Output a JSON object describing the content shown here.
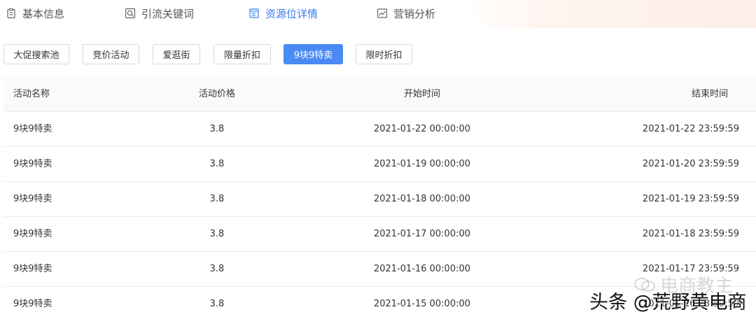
{
  "tabs": [
    {
      "label": "基本信息",
      "icon": "clipboard-icon",
      "active": false
    },
    {
      "label": "引流关键词",
      "icon": "search-doc-icon",
      "active": false
    },
    {
      "label": "资源位详情",
      "icon": "list-doc-icon",
      "active": true
    },
    {
      "label": "营销分析",
      "icon": "chart-icon",
      "active": false
    }
  ],
  "filters": [
    {
      "label": "大促搜索池",
      "active": false
    },
    {
      "label": "竞价活动",
      "active": false
    },
    {
      "label": "爱逛街",
      "active": false
    },
    {
      "label": "限量折扣",
      "active": false
    },
    {
      "label": "9块9特卖",
      "active": true
    },
    {
      "label": "限时折扣",
      "active": false
    }
  ],
  "table": {
    "headers": {
      "name": "活动名称",
      "price": "活动价格",
      "start": "开始时间",
      "end": "结束时间"
    },
    "rows": [
      {
        "name": "9块9特卖",
        "price": "3.8",
        "start": "2021-01-22 00:00:00",
        "end": "2021-01-22 23:59:59"
      },
      {
        "name": "9块9特卖",
        "price": "3.8",
        "start": "2021-01-19 00:00:00",
        "end": "2021-01-20 23:59:59"
      },
      {
        "name": "9块9特卖",
        "price": "3.8",
        "start": "2021-01-18 00:00:00",
        "end": "2021-01-19 23:59:59"
      },
      {
        "name": "9块9特卖",
        "price": "3.8",
        "start": "2021-01-17 00:00:00",
        "end": "2021-01-18 23:59:59"
      },
      {
        "name": "9块9特卖",
        "price": "3.8",
        "start": "2021-01-16 00:00:00",
        "end": "2021-01-17 23:59:59"
      },
      {
        "name": "9块9特卖",
        "price": "3.8",
        "start": "2021-01-15 00:00:00",
        "end": "2021-01-16 23:59:59"
      }
    ]
  },
  "watermark": {
    "back_text": "电商教主",
    "front_text": "头条 @荒野黄电商"
  },
  "colors": {
    "accent": "#3b7bf0",
    "chip_active": "#4a8af4"
  }
}
